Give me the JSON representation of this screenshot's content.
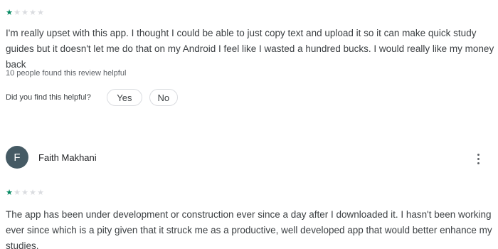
{
  "reviews": [
    {
      "rating": 1,
      "max_rating": 5,
      "text": "I'm really upset with this app. I thought I could be able to just copy text and upload it so it can make quick study guides but it doesn't let me do that on my Android I feel like I wasted a hundred bucks. I would really like my money back",
      "helpful_count_text": "10 people found this review helpful",
      "helpful_question": "Did you find this helpful?",
      "yes_label": "Yes",
      "no_label": "No"
    },
    {
      "author": "Faith Makhani",
      "avatar_initial": "F",
      "avatar_color": "#455a64",
      "rating": 1,
      "max_rating": 5,
      "text": "The app has been under development or construction ever since a day after I downloaded it. I hasn't been working ever since which is a pity given that it struck me as a productive, well developed app that would better enhance my studies."
    }
  ],
  "colors": {
    "star_filled": "#01875f",
    "star_empty": "#dadce0",
    "pill_border": "#dadce0"
  },
  "icons": {
    "more_menu": "more-vert-icon",
    "star": "star-icon"
  }
}
